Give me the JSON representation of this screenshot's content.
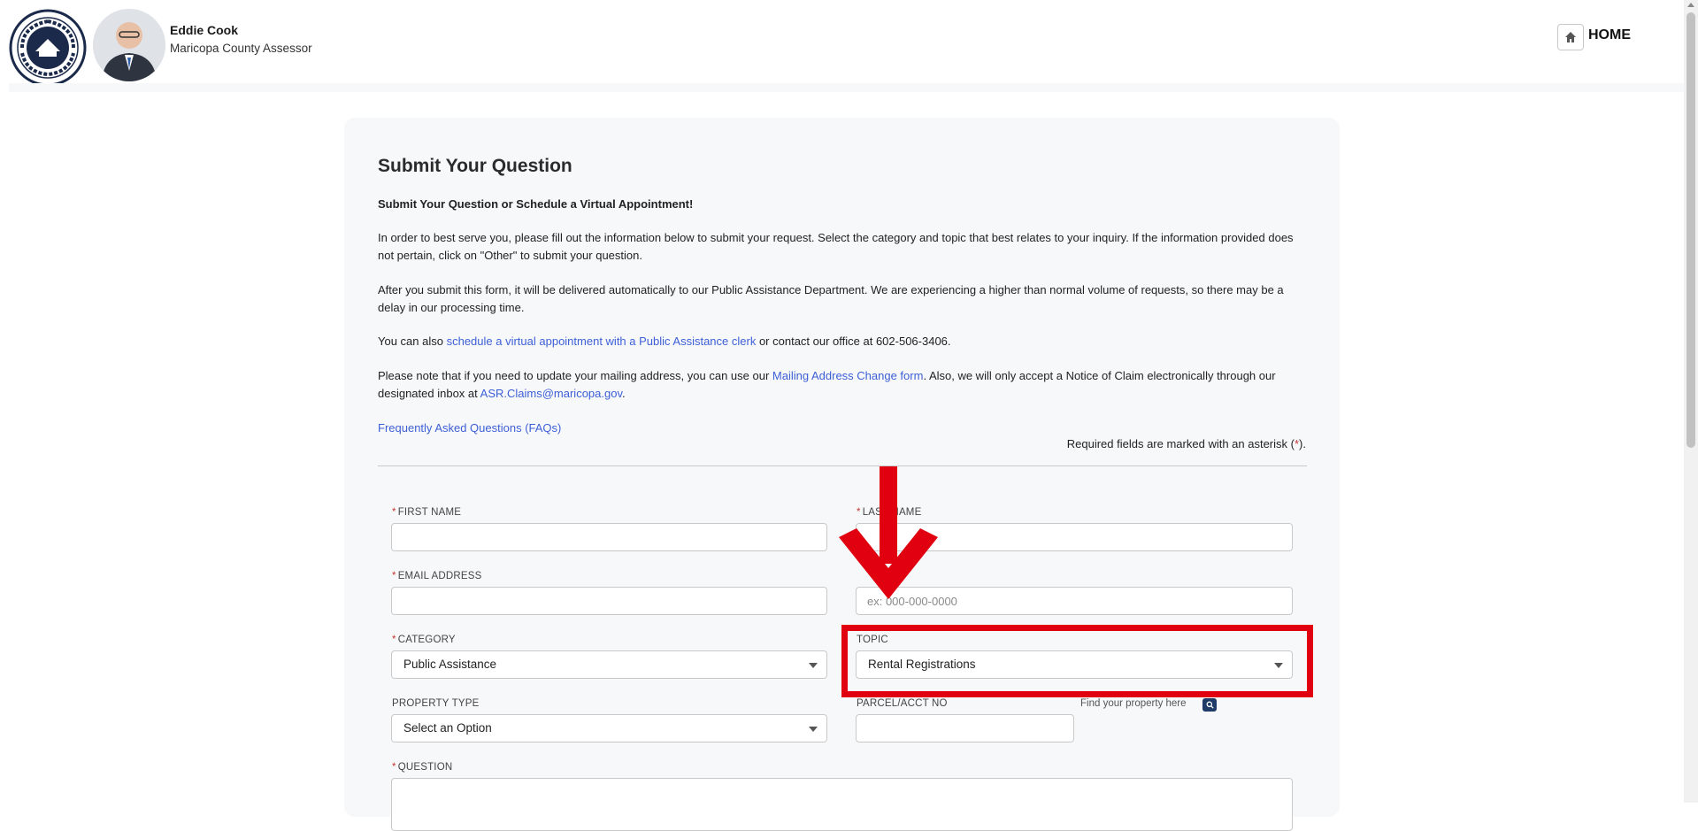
{
  "header": {
    "seal_text": "MARICOPA COUNTY",
    "seal_state": "ARIZONA",
    "person_name": "Eddie Cook",
    "person_title": "Maricopa County Assessor",
    "home_label": "HOME",
    "home_icon": "home-icon"
  },
  "content": {
    "title": "Submit Your Question",
    "subtitle": "Submit Your Question or Schedule a Virtual Appointment!",
    "para1": "In order to best serve you, please fill out the information below to submit your request. Select the category and topic that best relates to your inquiry. If the information provided does not pertain, click on \"Other\" to submit your question.",
    "para2": "After you submit this form, it will be delivered automatically to our Public Assistance Department. We are experiencing a higher than normal volume of requests, so there may be a delay in our processing time.",
    "para3_pre": "You can also ",
    "para3_link": "schedule a virtual appointment with a Public Assistance clerk",
    "para3_post": " or contact our office at 602-506-3406.",
    "para4_pre": "Please note that if you need to update your mailing address, you can use our ",
    "para4_link1": "Mailing Address Change form",
    "para4_mid": ". Also, we will only accept a Notice of Claim electronically through our designated inbox at ",
    "para4_link2": "ASR.Claims@maricopa.gov",
    "para4_post": ".",
    "faq_link": "Frequently Asked Questions (FAQs)",
    "required_note_pre": "Required fields are marked with an asterisk (",
    "required_star": "*",
    "required_note_post": ")."
  },
  "form": {
    "required_mark": "*",
    "first_name_label": "FIRST NAME",
    "first_name_value": "",
    "last_name_label": "LAST NAME",
    "last_name_value": "",
    "email_label": "EMAIL ADDRESS",
    "email_value": "",
    "phone_placeholder": "ex: 000-000-0000",
    "category_label": "CATEGORY",
    "category_value": "Public Assistance",
    "topic_label": "TOPIC",
    "topic_value": "Rental Registrations",
    "property_type_label": "PROPERTY TYPE",
    "property_type_value": "Select an Option",
    "parcel_label": "PARCEL/ACCT NO",
    "parcel_value": "",
    "find_property_label": "Find your property here",
    "find_property_icon": "search-icon",
    "question_label": "QUESTION"
  },
  "annotation": {
    "color": "#e0000f",
    "arrow_icon": "down-arrow-icon"
  }
}
